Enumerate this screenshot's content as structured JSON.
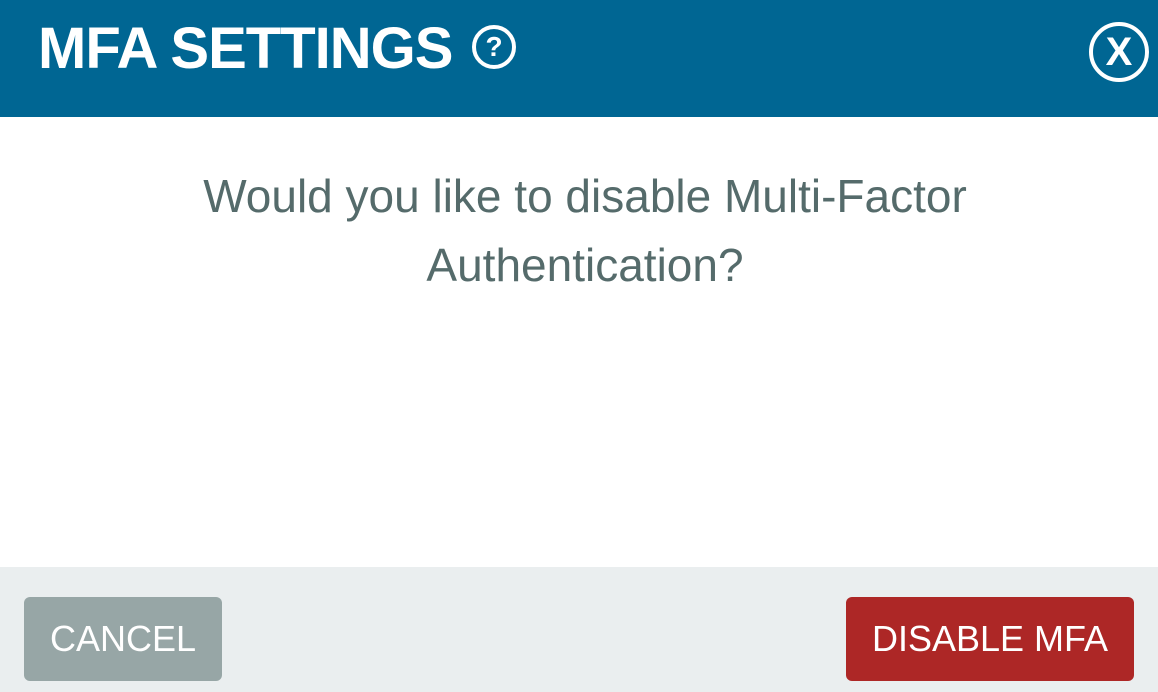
{
  "dialog": {
    "title": "MFA SETTINGS",
    "help_icon": "?",
    "close_icon": "X",
    "message": "Would you like to disable Multi-Factor Authentication?",
    "cancel_label": "CANCEL",
    "confirm_label": "DISABLE MFA"
  },
  "icons": {
    "help": "question-circle-icon",
    "close": "close-circle-icon"
  },
  "colors": {
    "header_bg": "#006693",
    "message_text": "#556b6b",
    "footer_bg": "#eaeeef",
    "cancel_bg": "#97a6a6",
    "confirm_bg": "#ad2726"
  }
}
